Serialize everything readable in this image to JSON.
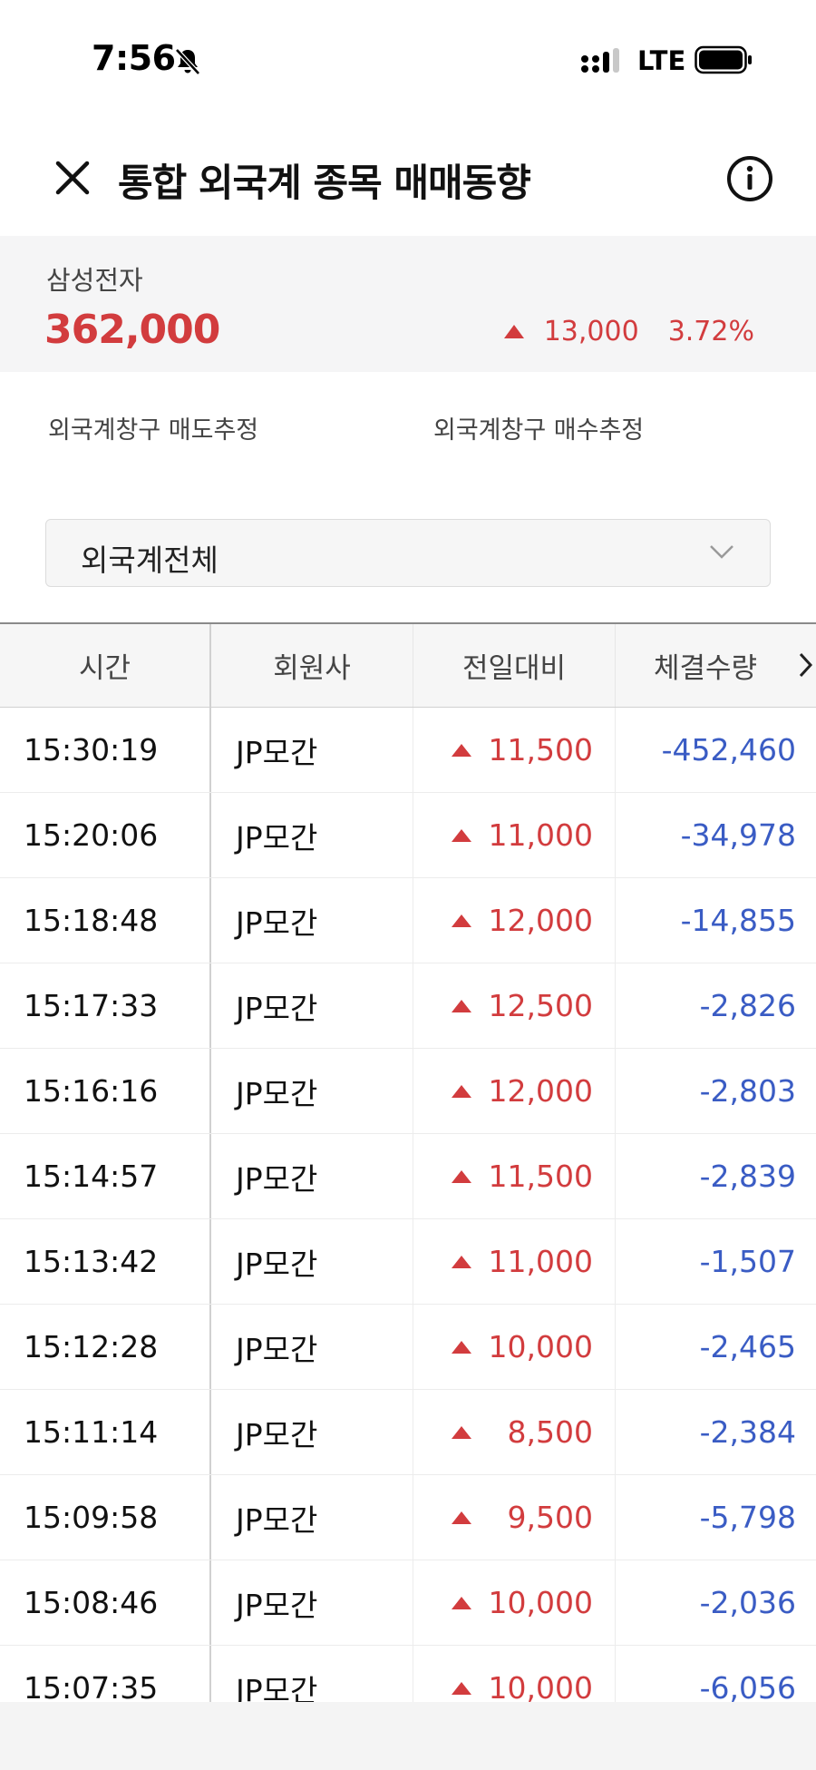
{
  "status_bar": {
    "time": "7:56",
    "network": "LTE"
  },
  "header": {
    "title": "통합 외국계 종목 매매동향"
  },
  "stock": {
    "name": "삼성전자",
    "price": "362,000",
    "change": "13,000",
    "change_pct": "3.72%"
  },
  "estimates": {
    "sell_label": "외국계창구 매도추정",
    "buy_label": "외국계창구 매수추정"
  },
  "filter": {
    "selected": "외국계전체"
  },
  "table": {
    "headers": [
      "시간",
      "회원사",
      "전일대비",
      "체결수량"
    ],
    "rows": [
      {
        "time": "15:30:19",
        "member": "JP모간",
        "diff": "11,500",
        "qty": "-452,460"
      },
      {
        "time": "15:20:06",
        "member": "JP모간",
        "diff": "11,000",
        "qty": "-34,978"
      },
      {
        "time": "15:18:48",
        "member": "JP모간",
        "diff": "12,000",
        "qty": "-14,855"
      },
      {
        "time": "15:17:33",
        "member": "JP모간",
        "diff": "12,500",
        "qty": "-2,826"
      },
      {
        "time": "15:16:16",
        "member": "JP모간",
        "diff": "12,000",
        "qty": "-2,803"
      },
      {
        "time": "15:14:57",
        "member": "JP모간",
        "diff": "11,500",
        "qty": "-2,839"
      },
      {
        "time": "15:13:42",
        "member": "JP모간",
        "diff": "11,000",
        "qty": "-1,507"
      },
      {
        "time": "15:12:28",
        "member": "JP모간",
        "diff": "10,000",
        "qty": "-2,465"
      },
      {
        "time": "15:11:14",
        "member": "JP모간",
        "diff": "8,500",
        "qty": "-2,384"
      },
      {
        "time": "15:09:58",
        "member": "JP모간",
        "diff": "9,500",
        "qty": "-5,798"
      },
      {
        "time": "15:08:46",
        "member": "JP모간",
        "diff": "10,000",
        "qty": "-2,036"
      },
      {
        "time": "15:07:35",
        "member": "JP모간",
        "diff": "10,000",
        "qty": "-6,056"
      }
    ]
  },
  "colors": {
    "up": "#d23c3e",
    "down": "#3a5cc4"
  }
}
